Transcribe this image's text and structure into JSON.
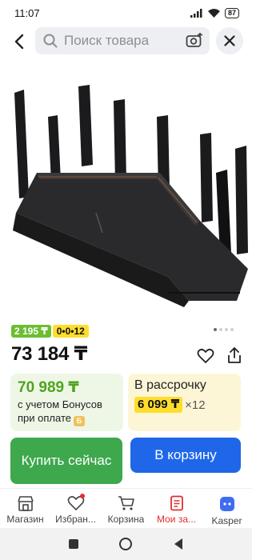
{
  "status": {
    "time": "11:07",
    "battery": "87"
  },
  "search": {
    "placeholder": "Поиск товара"
  },
  "product": {
    "badge_bonus": "2 195 ₸",
    "badge_installment": "0•0•12",
    "price": "73 184 ₸",
    "bonus_price": "70 989 ₸",
    "bonus_note": "с учетом Бонусов при оплате",
    "installment_title": "В рассрочку",
    "monthly": "6 099 ₸",
    "months": "×12"
  },
  "actions": {
    "buy_label": "Купить сейчас",
    "cart_label": "В корзину"
  },
  "bottom_nav": {
    "items": [
      {
        "label": "Магазин",
        "icon": "shop-icon"
      },
      {
        "label": "Избран...",
        "icon": "heart-icon"
      },
      {
        "label": "Корзина",
        "icon": "cart-icon"
      },
      {
        "label": "Мои за...",
        "icon": "orders-icon"
      },
      {
        "label": "Kasper",
        "icon": "kaspi-assistant-icon"
      }
    ]
  },
  "colors": {
    "green": "#3da84c",
    "blue": "#1f67e8",
    "yellow": "#ffdd2d",
    "red": "#e12f2f"
  }
}
